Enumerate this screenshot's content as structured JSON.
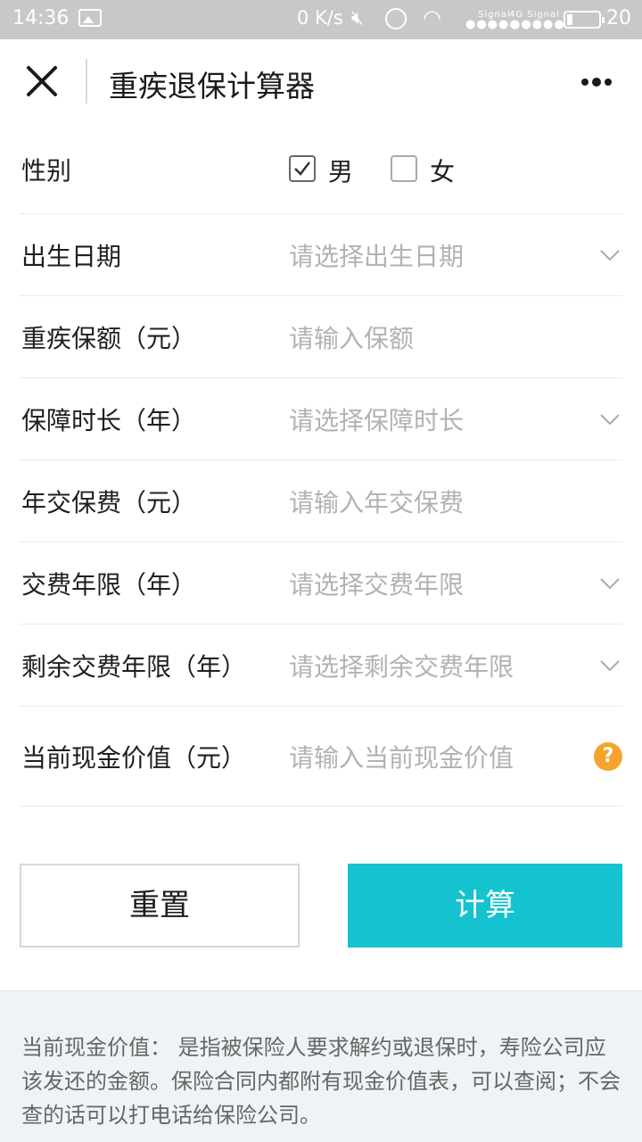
{
  "status_bar": {
    "time": "14:36",
    "net_speed": "0 K/s",
    "signal_label_1": "Signal",
    "signal_label_2": "4G Signal",
    "signal_dots": "●●●●●",
    "battery": "20",
    "icons": [
      "gallery-icon",
      "mute-icon",
      "alarm-icon",
      "wifi-icon",
      "battery-icon"
    ]
  },
  "nav": {
    "title": "重疾退保计算器",
    "close_icon": "close-icon",
    "more_icon": "more-icon"
  },
  "form": {
    "gender": {
      "label": "性别",
      "options": [
        {
          "label": "男",
          "checked": true
        },
        {
          "label": "女",
          "checked": false
        }
      ]
    },
    "fields": [
      {
        "label": "出生日期",
        "placeholder": "请选择出生日期",
        "type": "select"
      },
      {
        "label": "重疾保额（元）",
        "placeholder": "请输入保额",
        "type": "input"
      },
      {
        "label": "保障时长（年）",
        "placeholder": "请选择保障时长",
        "type": "select"
      },
      {
        "label": "年交保费（元）",
        "placeholder": "请输入年交保费",
        "type": "input"
      },
      {
        "label": "交费年限（年）",
        "placeholder": "请选择交费年限",
        "type": "select"
      },
      {
        "label": "剩余交费年限（年）",
        "placeholder": "请选择剩余交费年限",
        "type": "select"
      },
      {
        "label": "当前现金价值（元）",
        "placeholder": "请输入当前现金价值",
        "type": "input-help"
      }
    ],
    "help_glyph": "?"
  },
  "buttons": {
    "reset": "重置",
    "calculate": "计算"
  },
  "note": {
    "text": "当前现金价值： 是指被保险人要求解约或退保时，寿险公司应该发还的金额。保险合同内都附有现金价值表，可以查阅；不会查的话可以打电话给保险公司。"
  },
  "colors": {
    "accent": "#14c3cf",
    "help": "#f4a42d",
    "status_bar": "#c8c8c8",
    "placeholder": "#b2b2b2"
  }
}
